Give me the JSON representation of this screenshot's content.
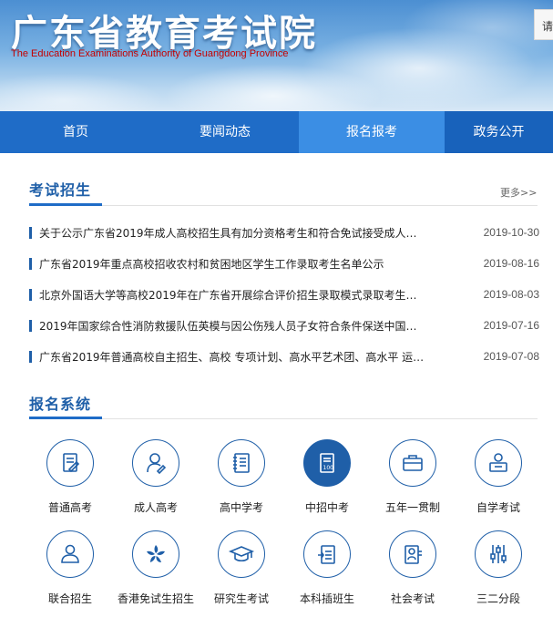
{
  "header": {
    "title_cn": "广东省教育考试院",
    "title_en": "The Education Examinations Authority of Guangdong Province",
    "login_partial": "请"
  },
  "nav": {
    "items": [
      {
        "label": "首页"
      },
      {
        "label": "要闻动态"
      },
      {
        "label": "报名报考",
        "active": true
      },
      {
        "label": "政务公开"
      }
    ]
  },
  "exam_section": {
    "title": "考试招生",
    "more": "更多>>",
    "news": [
      {
        "title": "关于公示广东省2019年成人高校招生具有加分资格考生和符合免试接受成人…",
        "date": "2019-10-30"
      },
      {
        "title": "广东省2019年重点高校招收农村和贫困地区学生工作录取考生名单公示",
        "date": "2019-08-16"
      },
      {
        "title": "北京外国语大学等高校2019年在广东省开展综合评价招生录取模式录取考生…",
        "date": "2019-08-03"
      },
      {
        "title": "2019年国家综合性消防救援队伍英模与因公伤残人员子女符合条件保送中国…",
        "date": "2019-07-16"
      },
      {
        "title": "广东省2019年普通高校自主招生、高校 专项计划、高水平艺术团、高水平 运…",
        "date": "2019-07-08"
      }
    ]
  },
  "system_section": {
    "title": "报名系统",
    "items": [
      {
        "label": "普通高考",
        "icon": "exam-paper-icon"
      },
      {
        "label": "成人高考",
        "icon": "adult-learner-icon"
      },
      {
        "label": "高中学考",
        "icon": "notebook-icon"
      },
      {
        "label": "中招中考",
        "icon": "score-sheet-icon",
        "active": true
      },
      {
        "label": "五年一贯制",
        "icon": "briefcase-icon"
      },
      {
        "label": "自学考试",
        "icon": "self-study-icon"
      },
      {
        "label": "联合招生",
        "icon": "group-icon"
      },
      {
        "label": "香港免试生招生",
        "icon": "bauhinia-icon"
      },
      {
        "label": "研究生考试",
        "icon": "graduation-cap-icon"
      },
      {
        "label": "本科插班生",
        "icon": "transfer-icon"
      },
      {
        "label": "社会考试",
        "icon": "certificate-icon"
      },
      {
        "label": "三二分段",
        "icon": "sliders-icon"
      }
    ]
  },
  "colors": {
    "nav_bg": "#1f6cc7",
    "nav_active": "#3b8ee4",
    "accent": "#1f5fa8",
    "logo_en": "#c40000"
  }
}
